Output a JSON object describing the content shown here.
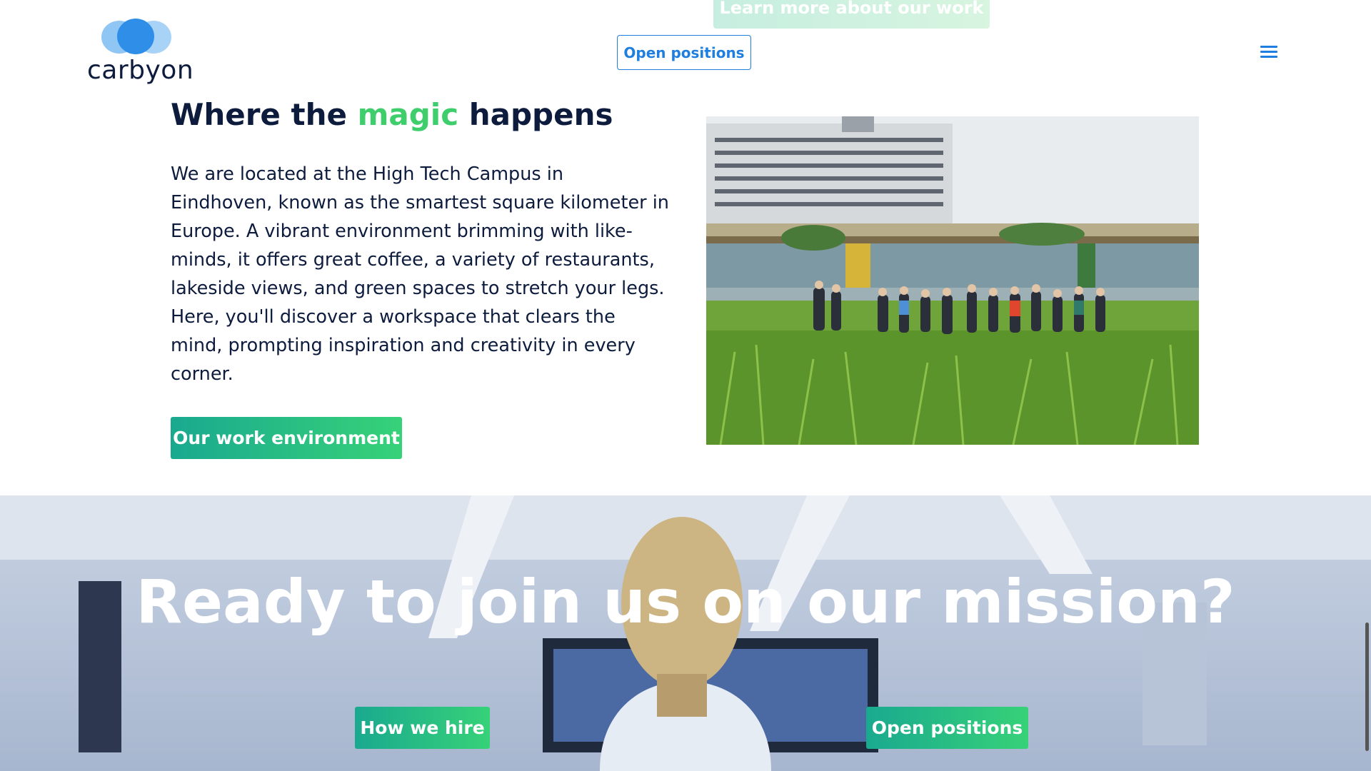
{
  "top_peek": {
    "button_label": "Learn more about our work"
  },
  "header": {
    "logo_text": "carbyon",
    "open_positions_label": "Open positions",
    "menu_icon": "hamburger-menu-icon"
  },
  "main": {
    "heading_before": "Where the ",
    "heading_accent": "magic",
    "heading_after": " happens",
    "paragraph": "We are located at the High Tech Campus in Eindhoven, known as the smartest square kilometer in Europe. A vibrant environment brimming with like-minds, it offers great coffee, a variety of restaurants, lakeside views, and green spaces to stretch your legs. Here, you'll discover a workspace that clears the mind, prompting inspiration and creativity in every corner.",
    "work_env_button": "Our work environment",
    "photo_icon": "campus-photo"
  },
  "cta": {
    "title": "Ready to join us on our mission?",
    "how_we_hire_label": "How we hire",
    "open_positions_label": "Open positions"
  },
  "colors": {
    "navy": "#0d1b3d",
    "accent_green": "#3fce6c",
    "brand_blue": "#1f7fe0",
    "button_gradient_start": "#1aa98f",
    "button_gradient_end": "#36d278"
  }
}
